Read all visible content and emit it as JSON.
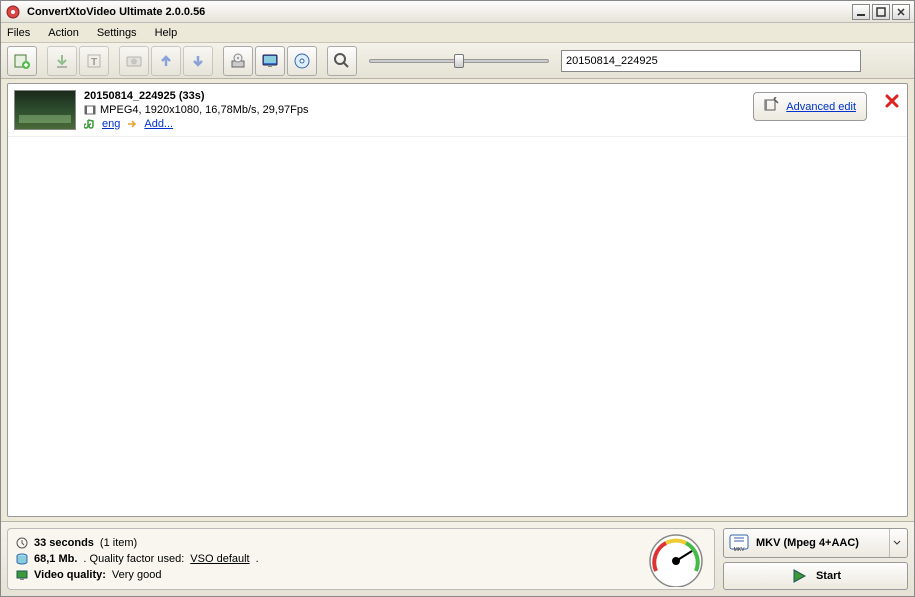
{
  "window": {
    "title": "ConvertXtoVideo Ultimate 2.0.0.56"
  },
  "menu": {
    "files": "Files",
    "action": "Action",
    "settings": "Settings",
    "help": "Help"
  },
  "toolbar": {
    "search_value": "20150814_224925"
  },
  "item": {
    "title": "20150814_224925 (33s)",
    "codec_line": "MPEG4, 1920x1080, 16,78Mb/s, 29,97Fps",
    "audio_lang": "eng",
    "add_label": "Add...",
    "advanced_edit": "Advanced edit"
  },
  "status": {
    "duration_bold": "33 seconds",
    "duration_count": "(1 item)",
    "size_bold": "68,1 Mb.",
    "size_rest": ". Quality factor used: ",
    "size_link": "VSO default",
    "quality_label": "Video quality:",
    "quality_value": "Very good"
  },
  "output": {
    "format": "MKV (Mpeg 4+AAC)",
    "format_short": "MKV",
    "start": "Start"
  }
}
